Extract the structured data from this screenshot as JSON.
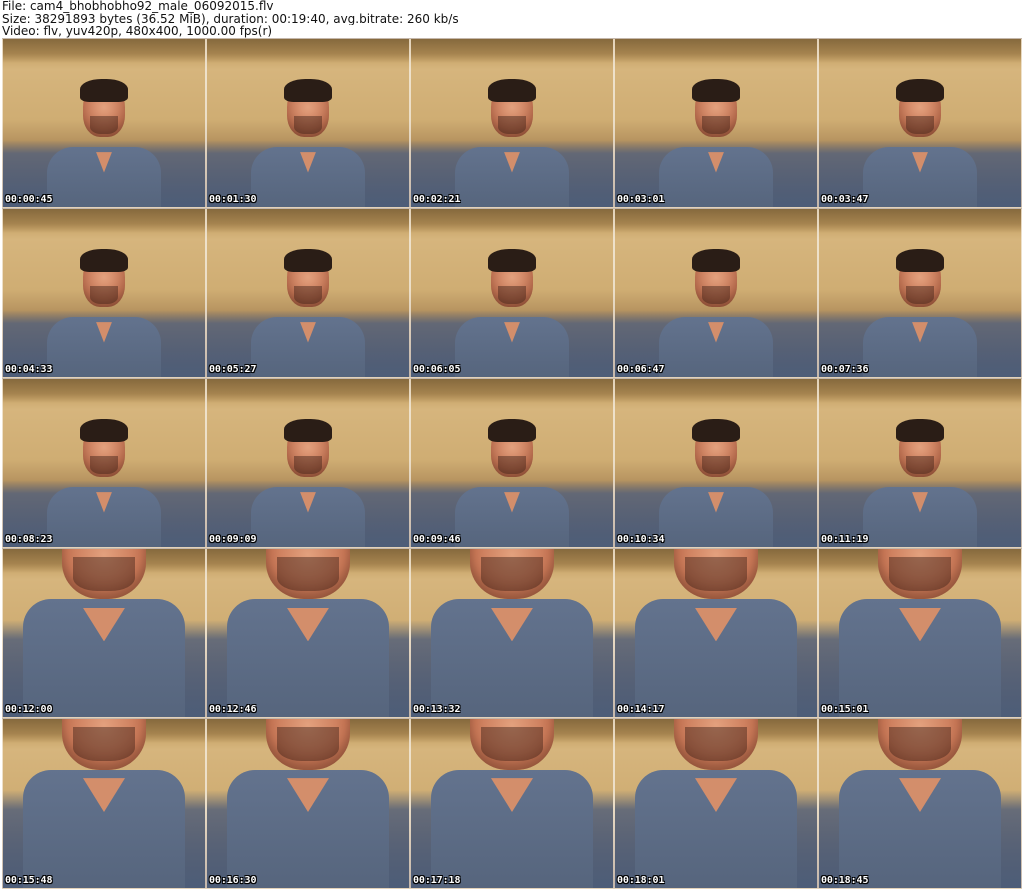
{
  "header": {
    "file_line": "File: cam4_bhobhobho92_male_06092015.flv",
    "size_line": "Size: 38291893 bytes (36.52 MiB), duration: 00:19:40, avg.bitrate: 260 kb/s",
    "video_line": "Video: flv, yuv420p, 480x400, 1000.00 fps(r)"
  },
  "thumbnails": [
    {
      "time": "00:00:45",
      "kind": "portrait"
    },
    {
      "time": "00:01:30",
      "kind": "portrait"
    },
    {
      "time": "00:02:21",
      "kind": "portrait"
    },
    {
      "time": "00:03:01",
      "kind": "portrait"
    },
    {
      "time": "00:03:47",
      "kind": "portrait"
    },
    {
      "time": "00:04:33",
      "kind": "portrait"
    },
    {
      "time": "00:05:27",
      "kind": "portrait"
    },
    {
      "time": "00:06:05",
      "kind": "portrait"
    },
    {
      "time": "00:06:47",
      "kind": "portrait"
    },
    {
      "time": "00:07:36",
      "kind": "portrait"
    },
    {
      "time": "00:08:23",
      "kind": "portrait"
    },
    {
      "time": "00:09:09",
      "kind": "portrait"
    },
    {
      "time": "00:09:46",
      "kind": "portrait"
    },
    {
      "time": "00:10:34",
      "kind": "portrait"
    },
    {
      "time": "00:11:19",
      "kind": "portrait"
    },
    {
      "time": "00:12:00",
      "kind": "closeup"
    },
    {
      "time": "00:12:46",
      "kind": "closeup"
    },
    {
      "time": "00:13:32",
      "kind": "closeup"
    },
    {
      "time": "00:14:17",
      "kind": "closeup"
    },
    {
      "time": "00:15:01",
      "kind": "closeup"
    },
    {
      "time": "00:15:48",
      "kind": "closeup"
    },
    {
      "time": "00:16:30",
      "kind": "closeup"
    },
    {
      "time": "00:17:18",
      "kind": "closeup"
    },
    {
      "time": "00:18:01",
      "kind": "closeup"
    },
    {
      "time": "00:18:45",
      "kind": "closeup"
    }
  ]
}
